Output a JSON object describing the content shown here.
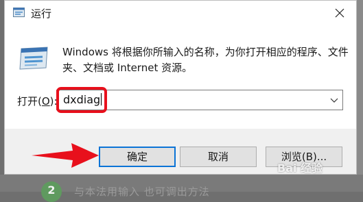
{
  "dialog": {
    "title": "运行",
    "description": "Windows 将根据你所输入的名称，为你打开相应的程序、文件夹、文档或 Internet 资源。",
    "open_label_pre": "打开(",
    "open_label_key": "O",
    "open_label_post": "):",
    "open_value": "dxdiag",
    "ok_label": "确定",
    "cancel_label": "取消",
    "browse_label": "浏览(B)..."
  },
  "background": {
    "step_number": "2",
    "step_text": "与本法用输入 也可调出方法"
  },
  "watermark": "Bai 经验",
  "colors": {
    "highlight": "#e8101c",
    "ok_border": "#0a73d6"
  },
  "icons": {
    "title_icon": "run-icon",
    "big_icon": "run-icon",
    "close_icon": "close-icon",
    "dropdown_icon": "chevron-down-icon",
    "arrow": "red-arrow-annotation"
  }
}
